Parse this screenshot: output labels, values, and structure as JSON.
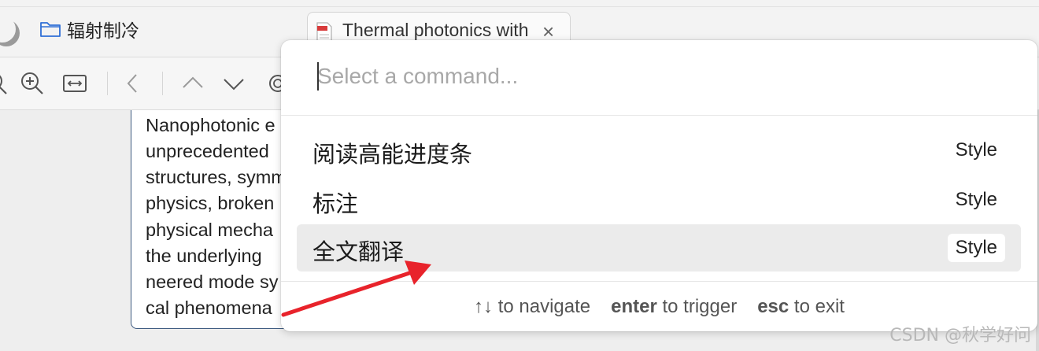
{
  "tabs": {
    "folder_label": "辐射制冷",
    "doc_title": "Thermal photonics with",
    "close_glyph": "×"
  },
  "toolbar": {
    "icons": [
      "zoom-in-icon",
      "fit-width-icon",
      "back-icon",
      "scroll-up-icon",
      "scroll-down-icon",
      "ai-icon"
    ]
  },
  "document": {
    "lines": [
      "Nanophotonic e",
      "unprecedented",
      "structures, symm",
      "physics, broken",
      "physical mecha",
      "the underlying",
      "neered mode sy",
      "cal phenomena"
    ]
  },
  "palette": {
    "placeholder": "Select a command...",
    "commands": [
      {
        "label": "阅读高能进度条",
        "tag": "Style",
        "selected": false
      },
      {
        "label": "标注",
        "tag": "Style",
        "selected": false
      },
      {
        "label": "全文翻译",
        "tag": "Style",
        "selected": true
      }
    ],
    "footer": {
      "nav_key": "↑↓",
      "nav_text": "to navigate",
      "enter_key": "enter",
      "enter_text": "to trigger",
      "esc_key": "esc",
      "esc_text": "to exit"
    }
  },
  "watermark": "CSDN @秋学好问",
  "colors": {
    "annotation_arrow": "#e8232b",
    "selected_row": "#ebebeb",
    "box_border": "#3d5a80"
  }
}
